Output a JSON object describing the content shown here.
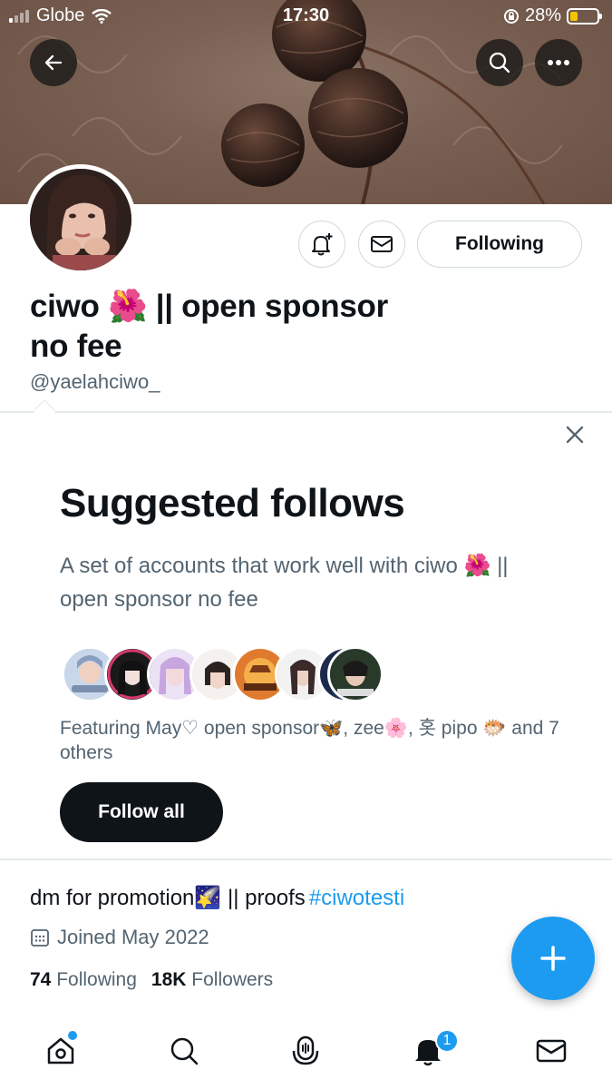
{
  "status_bar": {
    "carrier": "Globe",
    "time": "17:30",
    "battery_percent": "28%",
    "battery_level": 0.28
  },
  "profile": {
    "display_name_line1": "ciwo 🌺 || open sponsor",
    "display_name_line2": "no fee",
    "handle": "@yaelahciwo_",
    "following_button": "Following",
    "bio_text": "dm for promotion🌠 || proofs",
    "bio_hashtag": "#ciwotesti",
    "joined": "Joined May 2022",
    "following_count": "74",
    "following_label": "Following",
    "followers_count": "18K",
    "followers_label": "Followers"
  },
  "suggested": {
    "title": "Suggested follows",
    "description": "A set of accounts that work well with ciwo 🌺 || open sponsor no fee",
    "featuring": "Featuring May♡ open sponsor🦋, zee🌸, 홋 pipo 🐡 and 7 others",
    "follow_all": "Follow all"
  },
  "tabbar": {
    "notification_badge": "1"
  },
  "colors": {
    "accent": "#1d9bf0",
    "text_primary": "#0f1419",
    "text_secondary": "#536471",
    "battery_fill": "#f5c400"
  },
  "icons": [
    "back-arrow-icon",
    "search-icon",
    "more-icon",
    "bell-plus-icon",
    "mail-icon",
    "close-icon",
    "calendar-icon",
    "plus-icon",
    "home-icon",
    "spaces-icon",
    "notifications-icon"
  ]
}
